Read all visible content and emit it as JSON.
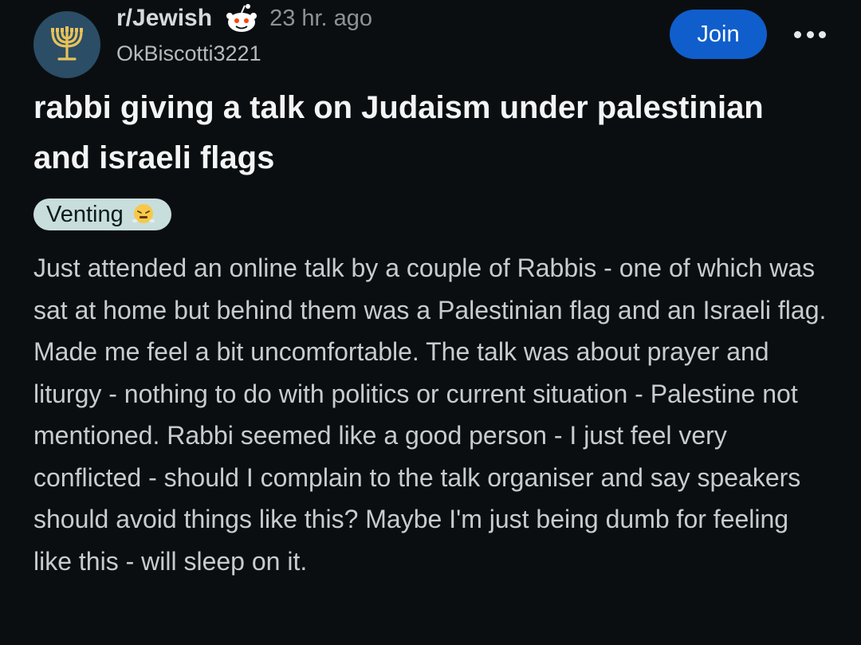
{
  "post": {
    "subreddit": "r/Jewish",
    "time_ago": "23 hr. ago",
    "author": "OkBiscotti3221",
    "join_label": "Join",
    "title": "rabbi giving a talk on Judaism under palestinian and israeli flags",
    "flair": {
      "label": "Venting",
      "emoji": "face-with-steam-from-nose"
    },
    "body": "Just attended an online talk by a couple of Rabbis - one of which was sat at home but behind them was a Palestinian flag and an Israeli flag. Made me feel a bit uncomfortable. The talk was about prayer and liturgy - nothing to do with politics or current situation - Palestine not mentioned. Rabbi seemed like a good person - I just feel very conflicted - should I complain to the talk organiser and say speakers should avoid things like this? Maybe I'm just being dumb for feeling like this - will sleep on it."
  },
  "icons": {
    "avatar": "menorah-icon",
    "subreddit_badge": "snoo-icon",
    "more": "more-options-icon"
  },
  "colors": {
    "background": "#0b0e10",
    "join_button": "#0f5ecc",
    "avatar_bg": "#2b4d66",
    "menorah": "#e8c25a",
    "flair_bg": "#c8dedd"
  }
}
